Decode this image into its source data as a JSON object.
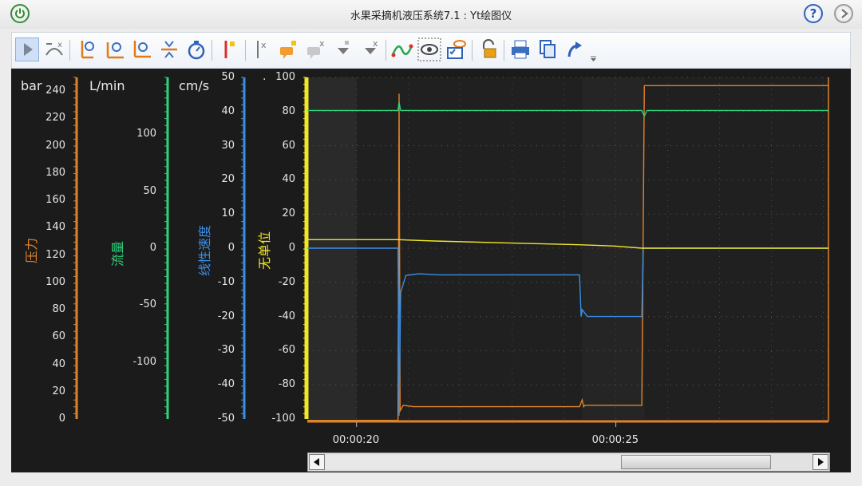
{
  "window": {
    "title": "水果采摘机液压系统7.1 : Yt绘图仪",
    "help_label": "?"
  },
  "toolbar": {
    "icons": [
      "cursor-arrow-icon",
      "scale-y-icon",
      "zoom-y-icon",
      "zoom-x-icon",
      "zoom-xy-icon",
      "compress-icon",
      "stopwatch-icon",
      "marker-red-icon",
      "marker-x-icon",
      "comment-add-icon",
      "comment-remove-icon",
      "marker-down-icon",
      "marker-down-x-icon",
      "curve-icon",
      "eye-icon",
      "eye-list-icon",
      "lock-icon",
      "print-icon",
      "copy-icon",
      "export-icon"
    ]
  },
  "axes": {
    "pressure": {
      "unit": "bar",
      "title": "压力",
      "color": "#e0822a",
      "ticks": [
        "240",
        "220",
        "200",
        "180",
        "160",
        "140",
        "120",
        "100",
        "80",
        "60",
        "40",
        "20",
        "0"
      ]
    },
    "flow": {
      "unit": "L/min",
      "title": "流量",
      "color": "#2ed37a",
      "ticks": [
        "100",
        "50",
        "0",
        "-50",
        "-100"
      ]
    },
    "velocity": {
      "unit": "cm/s",
      "title": "线性速度",
      "color": "#3a8fe6",
      "ticks": [
        "50",
        "40",
        "30",
        "20",
        "10",
        "0",
        "-10",
        "-20",
        "-30",
        "-40",
        "-50"
      ]
    },
    "unitless": {
      "unit": ".",
      "title": "无单位",
      "color": "#f2e62a",
      "ticks": [
        "100",
        "80",
        "60",
        "40",
        "20",
        "0",
        "-20",
        "-40",
        "-60",
        "-80",
        "-100"
      ]
    }
  },
  "x_axis": {
    "ticks": [
      "00:00:20",
      "00:00:25"
    ]
  },
  "chart_data": {
    "type": "line",
    "x_unit": "s",
    "x_range": [
      19.05,
      29.1
    ],
    "grid": true,
    "series": [
      {
        "name": "压力",
        "axis": "pressure",
        "color": "#e0822a",
        "points": [
          [
            19.05,
            -1
          ],
          [
            20.8,
            -1
          ],
          [
            20.82,
            238
          ],
          [
            20.84,
            6
          ],
          [
            20.9,
            10
          ],
          [
            21.1,
            9
          ],
          [
            24.3,
            9
          ],
          [
            24.35,
            14
          ],
          [
            24.38,
            9
          ],
          [
            24.4,
            10
          ],
          [
            25.5,
            10
          ],
          [
            25.55,
            244
          ],
          [
            29.1,
            244
          ]
        ]
      },
      {
        "name": "流量",
        "axis": "flow",
        "color": "#2ed37a",
        "points": [
          [
            19.05,
            121
          ],
          [
            20.8,
            121
          ],
          [
            20.82,
            128
          ],
          [
            20.85,
            121
          ],
          [
            25.5,
            121
          ],
          [
            25.55,
            116
          ],
          [
            25.6,
            121
          ],
          [
            29.1,
            121
          ]
        ]
      },
      {
        "name": "线性速度",
        "axis": "velocity",
        "color": "#3a8fe6",
        "points": [
          [
            19.05,
            0
          ],
          [
            20.8,
            0
          ],
          [
            20.82,
            -49
          ],
          [
            20.85,
            -13
          ],
          [
            20.95,
            -8
          ],
          [
            21.2,
            -7.5
          ],
          [
            21.6,
            -7.8
          ],
          [
            24.3,
            -7.8
          ],
          [
            24.33,
            -20
          ],
          [
            24.35,
            -18
          ],
          [
            24.45,
            -20
          ],
          [
            25.5,
            -20
          ],
          [
            25.53,
            0
          ],
          [
            29.1,
            0
          ]
        ]
      },
      {
        "name": "无单位",
        "axis": "unitless",
        "color": "#f2e62a",
        "points": [
          [
            19.05,
            5
          ],
          [
            20.8,
            5
          ],
          [
            21.5,
            4.2
          ],
          [
            23.0,
            3
          ],
          [
            24.3,
            2
          ],
          [
            25.0,
            1.2
          ],
          [
            25.5,
            0
          ],
          [
            29.1,
            0
          ]
        ]
      }
    ]
  }
}
